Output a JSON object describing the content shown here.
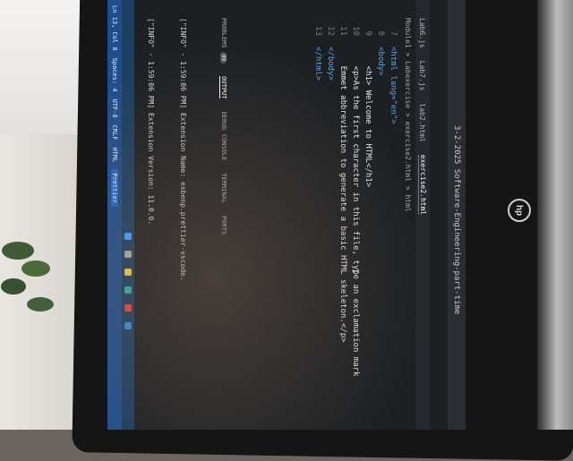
{
  "window": {
    "title": "3-2-2025 Software-Engineering-part-time"
  },
  "tabs": [
    {
      "label": "Lab6.js"
    },
    {
      "label": "Lab7.js"
    },
    {
      "label": "lab2.html"
    },
    {
      "label": "exercise2.html"
    }
  ],
  "breadcrumb": "Module1 > Labexercise > exercise2.html > html",
  "editor": {
    "lines": [
      {
        "n": "7",
        "text": "<html lang=\"en\">"
      },
      {
        "n": "8",
        "text": "<body>"
      },
      {
        "n": "9",
        "text": "    <h1> Welcome to HTML</h1>"
      },
      {
        "n": "10",
        "text": "    <p>As the first character in this file, type an exclamation mark"
      },
      {
        "n": "11",
        "text": "    Emmet abbreviation to generate a basic HTML skeleton.</p>"
      },
      {
        "n": "12",
        "text": "</body>"
      },
      {
        "n": "13",
        "text": "</html>"
      }
    ]
  },
  "panel": {
    "tabs": [
      "PROBLEMS",
      "OUTPUT",
      "DEBUG CONSOLE",
      "TERMINAL",
      "PORTS"
    ],
    "problems_count": "89",
    "active_tab": "OUTPUT",
    "output": [
      "[\"INFO\" - 1:59:06 PM] Extension Name: esbenp.prettier-vscode.",
      "[\"INFO\" - 1:59:06 PM] Extension Version: 11.0.0."
    ]
  },
  "statusbar": {
    "position": "Ln 13, Col 8",
    "spaces": "Spaces: 4",
    "encoding": "UTF-8",
    "eol": "CRLF",
    "language": "HTML",
    "formatter": "Prettier"
  },
  "brand": {
    "logo": "hp"
  },
  "colors": {
    "status_blue": "#1e4e8c",
    "tag_blue": "#5aa4e8",
    "string_orange": "#ce9178"
  }
}
